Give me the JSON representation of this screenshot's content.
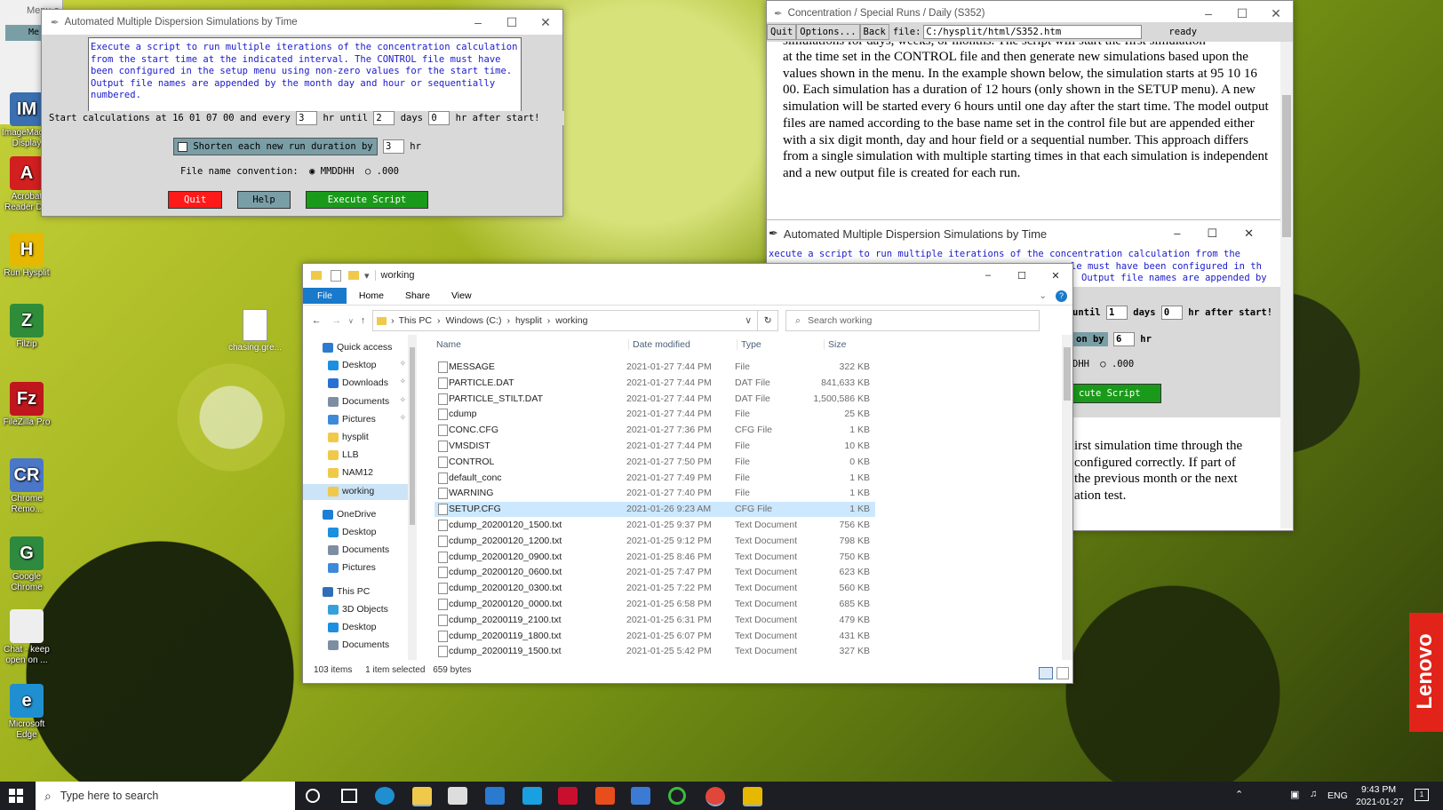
{
  "desktop": {
    "icons": [
      {
        "label": "ImageMagick Display",
        "color": "#3a6fb0",
        "glyph": "IM"
      },
      {
        "label": "Acrobat Reader DC",
        "color": "#d21f1f",
        "glyph": "A"
      },
      {
        "label": "Run Hysplit",
        "color": "#e6b800",
        "glyph": "H"
      },
      {
        "label": "Filzip",
        "color": "#2f8d3a",
        "glyph": "Z"
      },
      {
        "label": "FileZilla Pro",
        "color": "#c0161e",
        "glyph": "Fz"
      },
      {
        "label": "Chrome Remo...",
        "color": "#4a77c7",
        "glyph": "CR"
      },
      {
        "label": "Google Chrome",
        "color": "#2d8a3e",
        "glyph": "G"
      },
      {
        "label": "Chat - keep open on ...",
        "color": "#eeeeee",
        "glyph": ""
      },
      {
        "label": "Microsoft Edge",
        "color": "#1f8fd0",
        "glyph": "e"
      }
    ],
    "file_icon_label": "chasing.gre...",
    "behind_title": "Menu of Hysplit",
    "behind_menu": "Me",
    "lenovo": "Lenovo"
  },
  "sim_window": {
    "title": "Automated Multiple Dispersion Simulations by Time",
    "description": "Execute a script to run multiple iterations of the concentration calculation from the start time at the indicated interval. The CONTROL file must have been configured in the setup menu using non-zero values for the start time. Output file names are appended by the month day and hour or sequentially numbered.",
    "start_text": "Start calculations at 16 01 07 00 and every",
    "every_value": "3",
    "hr_until": "hr until",
    "days_value": "2",
    "days_label": "days",
    "after_value": "0",
    "after_label": "hr after start!",
    "shorten_label": "Shorten each new run duration by",
    "shorten_value": "3",
    "shorten_unit": "hr",
    "convention_label": "File name convention:",
    "opt1": "MMDDHH",
    "opt2": ".000",
    "quit": "Quit",
    "help": "Help",
    "execute": "Execute Script"
  },
  "help_window": {
    "title": "Concentration / Special Runs / Daily (S352)",
    "quit": "Quit",
    "options": "Options...",
    "back": "Back",
    "file_label": "file:",
    "file_path": "C:/hysplit/html/S352.htm",
    "status": "ready",
    "top_fragment": "simulations for days, weeks, or months. The script will start the first simulation",
    "body": "at the time set in the CONTROL file and then generate new simulations based upon the values shown in the menu. In the example shown below, the simulation starts at 95 10 16 00. Each simulation has a duration of 12 hours (only shown in the SETUP menu). A new simulation will be started every 6 hours until one day after the start time. The model output files are named according to the base name set in the control file but are appended either with a six digit month, day and hour field or a sequential number. This approach differs from a single simulation with multiple starting times in that each simulation is independent and a new output file is created for each run.",
    "embedded_title": "Automated Multiple Dispersion Simulations by Time",
    "emb_line1": "xecute a script to run multiple iterations of the concentration calculation from the",
    "emb_line2": "le must have been configured in th",
    "emb_line3": "Output file names are appended by",
    "emb_until": "until",
    "emb_days_val": "1",
    "emb_days": "days",
    "emb_after_val": "0",
    "emb_after": "hr after start!",
    "emb_by": "on by",
    "emb_by_val": "6",
    "emb_hr": "hr",
    "emb_dhh": "DHH",
    "emb_000": ".000",
    "emb_exec": "cute Script",
    "tail1": "irst simulation time through the",
    "tail2": "configured correctly. If part of",
    "tail3": "the previous month or the next",
    "tail4": "ation test."
  },
  "explorer": {
    "title": "working",
    "tabs": [
      "File",
      "Home",
      "Share",
      "View"
    ],
    "breadcrumb": [
      "This PC",
      "Windows (C:)",
      "hysplit",
      "working"
    ],
    "search_placeholder": "Search working",
    "columns": [
      "Name",
      "Date modified",
      "Type",
      "Size"
    ],
    "nav": [
      {
        "label": "Quick access",
        "kind": "star",
        "indent": 0
      },
      {
        "label": "Desktop",
        "kind": "blue",
        "indent": 1,
        "pin": true
      },
      {
        "label": "Downloads",
        "kind": "down",
        "indent": 1,
        "pin": true
      },
      {
        "label": "Documents",
        "kind": "doc",
        "indent": 1,
        "pin": true
      },
      {
        "label": "Pictures",
        "kind": "pic",
        "indent": 1,
        "pin": true
      },
      {
        "label": "hysplit",
        "kind": "folder",
        "indent": 1
      },
      {
        "label": "LLB",
        "kind": "folder",
        "indent": 1
      },
      {
        "label": "NAM12",
        "kind": "folder",
        "indent": 1
      },
      {
        "label": "working",
        "kind": "folder",
        "indent": 1,
        "selected": true
      },
      {
        "label": "OneDrive",
        "kind": "cloud",
        "indent": 0,
        "gap": true
      },
      {
        "label": "Desktop",
        "kind": "blue",
        "indent": 1
      },
      {
        "label": "Documents",
        "kind": "doc",
        "indent": 1
      },
      {
        "label": "Pictures",
        "kind": "pic",
        "indent": 1
      },
      {
        "label": "This PC",
        "kind": "pc",
        "indent": 0,
        "gap": true
      },
      {
        "label": "3D Objects",
        "kind": "cube",
        "indent": 1
      },
      {
        "label": "Desktop",
        "kind": "blue",
        "indent": 1
      },
      {
        "label": "Documents",
        "kind": "doc",
        "indent": 1
      }
    ],
    "files": [
      {
        "name": "MESSAGE",
        "date": "2021-01-27 7:44 PM",
        "type": "File",
        "size": "322 KB"
      },
      {
        "name": "PARTICLE.DAT",
        "date": "2021-01-27 7:44 PM",
        "type": "DAT File",
        "size": "841,633 KB"
      },
      {
        "name": "PARTICLE_STILT.DAT",
        "date": "2021-01-27 7:44 PM",
        "type": "DAT File",
        "size": "1,500,586 KB"
      },
      {
        "name": "cdump",
        "date": "2021-01-27 7:44 PM",
        "type": "File",
        "size": "25 KB"
      },
      {
        "name": "CONC.CFG",
        "date": "2021-01-27 7:36 PM",
        "type": "CFG File",
        "size": "1 KB"
      },
      {
        "name": "VMSDIST",
        "date": "2021-01-27 7:44 PM",
        "type": "File",
        "size": "10 KB"
      },
      {
        "name": "CONTROL",
        "date": "2021-01-27 7:50 PM",
        "type": "File",
        "size": "0 KB"
      },
      {
        "name": "default_conc",
        "date": "2021-01-27 7:49 PM",
        "type": "File",
        "size": "1 KB"
      },
      {
        "name": "WARNING",
        "date": "2021-01-27 7:40 PM",
        "type": "File",
        "size": "1 KB"
      },
      {
        "name": "SETUP.CFG",
        "date": "2021-01-26 9:23 AM",
        "type": "CFG File",
        "size": "1 KB",
        "selected": true
      },
      {
        "name": "cdump_20200120_1500.txt",
        "date": "2021-01-25 9:37 PM",
        "type": "Text Document",
        "size": "756 KB"
      },
      {
        "name": "cdump_20200120_1200.txt",
        "date": "2021-01-25 9:12 PM",
        "type": "Text Document",
        "size": "798 KB"
      },
      {
        "name": "cdump_20200120_0900.txt",
        "date": "2021-01-25 8:46 PM",
        "type": "Text Document",
        "size": "750 KB"
      },
      {
        "name": "cdump_20200120_0600.txt",
        "date": "2021-01-25 7:47 PM",
        "type": "Text Document",
        "size": "623 KB"
      },
      {
        "name": "cdump_20200120_0300.txt",
        "date": "2021-01-25 7:22 PM",
        "type": "Text Document",
        "size": "560 KB"
      },
      {
        "name": "cdump_20200120_0000.txt",
        "date": "2021-01-25 6:58 PM",
        "type": "Text Document",
        "size": "685 KB"
      },
      {
        "name": "cdump_20200119_2100.txt",
        "date": "2021-01-25 6:31 PM",
        "type": "Text Document",
        "size": "479 KB"
      },
      {
        "name": "cdump_20200119_1800.txt",
        "date": "2021-01-25 6:07 PM",
        "type": "Text Document",
        "size": "431 KB"
      },
      {
        "name": "cdump_20200119_1500.txt",
        "date": "2021-01-25 5:42 PM",
        "type": "Text Document",
        "size": "327 KB"
      }
    ],
    "status_items": "103 items",
    "status_selected": "1 item selected",
    "status_size": "659 bytes"
  },
  "taskbar": {
    "search_placeholder": "Type here to search",
    "lang": "ENG",
    "time": "9:43 PM",
    "date": "2021-01-27",
    "notif": "1"
  }
}
